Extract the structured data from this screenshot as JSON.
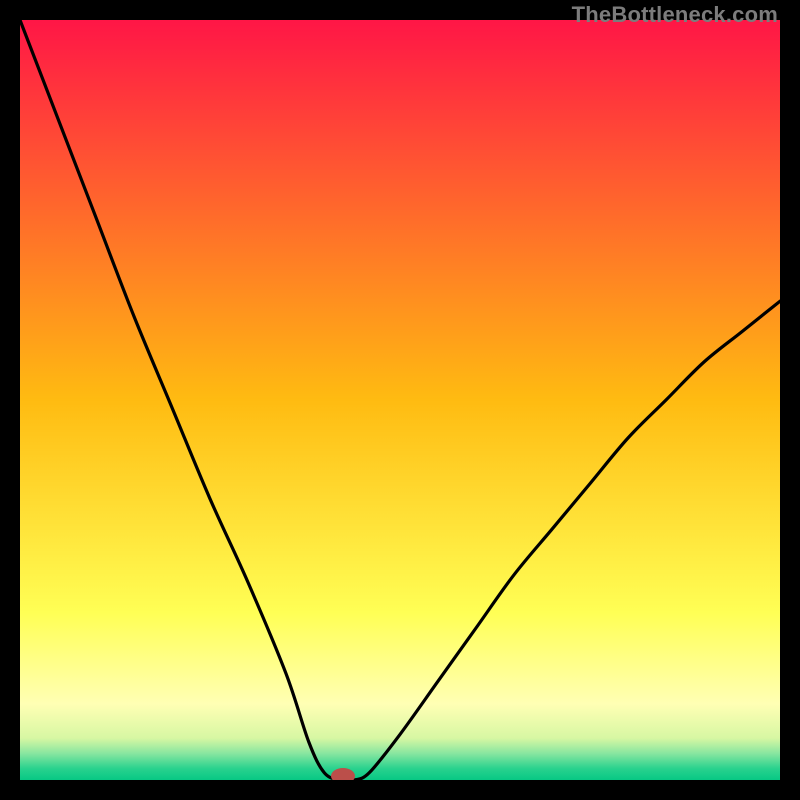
{
  "watermark": "TheBottleneck.com",
  "chart_data": {
    "type": "line",
    "title": "",
    "xlabel": "",
    "ylabel": "",
    "xlim": [
      0,
      100
    ],
    "ylim": [
      0,
      100
    ],
    "series": [
      {
        "name": "bottleneck-curve",
        "x": [
          0,
          5,
          10,
          15,
          20,
          25,
          30,
          35,
          38,
          40,
          42,
          44,
          46,
          50,
          55,
          60,
          65,
          70,
          75,
          80,
          85,
          90,
          95,
          100
        ],
        "y": [
          100,
          87,
          74,
          61,
          49,
          37,
          26,
          14,
          5,
          1,
          0,
          0,
          1,
          6,
          13,
          20,
          27,
          33,
          39,
          45,
          50,
          55,
          59,
          63
        ]
      }
    ],
    "marker": {
      "x": 42.5,
      "y": 0,
      "color": "#bb4f4a"
    },
    "gradient_stops": [
      {
        "offset": 0.0,
        "color": "#ff1646"
      },
      {
        "offset": 0.5,
        "color": "#ffbb11"
      },
      {
        "offset": 0.78,
        "color": "#ffff55"
      },
      {
        "offset": 0.9,
        "color": "#ffffb4"
      },
      {
        "offset": 0.945,
        "color": "#d7f7a3"
      },
      {
        "offset": 0.965,
        "color": "#88e6a0"
      },
      {
        "offset": 0.985,
        "color": "#29d28e"
      },
      {
        "offset": 1.0,
        "color": "#07c884"
      }
    ]
  }
}
